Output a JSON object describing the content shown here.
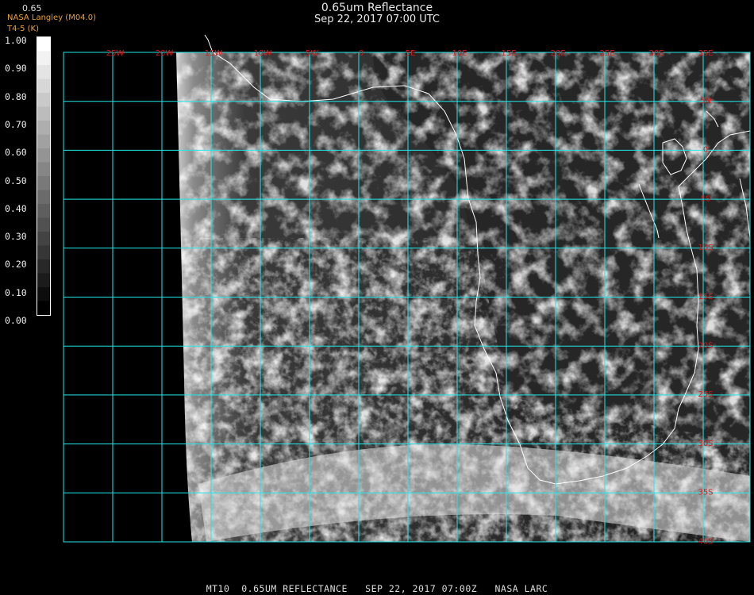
{
  "header": {
    "title": "0.65um Reflectance",
    "datetime": "Sep 22, 2017 07:00 UTC",
    "credit": "NASA Langley (M04.0)",
    "credit_sub": "T4-5 (K)",
    "colorbar_label": "0.65"
  },
  "colorbar": {
    "ticks": [
      "1.00",
      "0.90",
      "0.80",
      "0.70",
      "0.60",
      "0.50",
      "0.40",
      "0.30",
      "0.20",
      "0.10",
      "0.00"
    ]
  },
  "map": {
    "longitude_labels": [
      "25W",
      "20W",
      "15W",
      "10W",
      "5W",
      "0",
      "5E",
      "10E",
      "15E",
      "20E",
      "25E",
      "30E",
      "35E"
    ],
    "latitude_labels": [
      "5N",
      "0",
      "5S",
      "10S",
      "15S",
      "20S",
      "25S",
      "30S",
      "35S",
      "40S"
    ],
    "grid_color": "#20e8e8",
    "label_color": "#d81818",
    "coastline_color": "#ffffff"
  },
  "footer": {
    "product": "MT10",
    "channel": "0.65UM REFLECTANCE",
    "datetime": "SEP 22, 2017 07:00Z",
    "source": "NASA LARC"
  }
}
